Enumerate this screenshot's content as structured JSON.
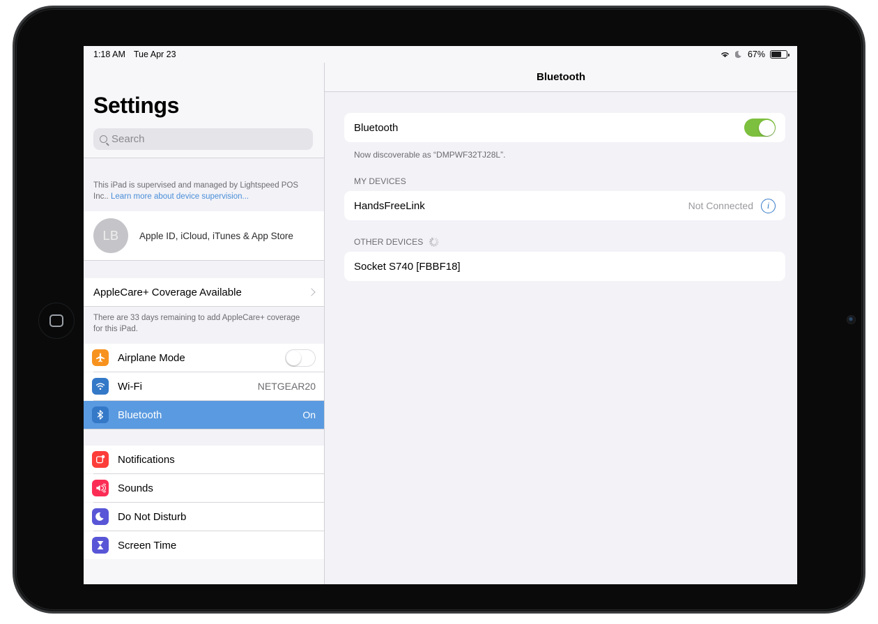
{
  "status_bar": {
    "time": "1:18 AM",
    "date": "Tue Apr 23",
    "wifi_icon": "wifi-icon",
    "dnd_icon": "moon-icon",
    "battery_percent": "67%",
    "battery_level": 67
  },
  "sidebar": {
    "title": "Settings",
    "search": {
      "placeholder": "Search",
      "icon": "search-icon"
    },
    "supervision": {
      "text": "This iPad is supervised and managed by Lightspeed POS Inc..",
      "link": "Learn more about device supervision..."
    },
    "apple_id": {
      "initials": "LB",
      "label": "Apple ID, iCloud, iTunes & App Store"
    },
    "applecare": {
      "title": "AppleCare+ Coverage Available",
      "footnote": "There are 33 days remaining to add AppleCare+ coverage for this iPad."
    },
    "items": [
      {
        "label": "Airplane Mode",
        "icon": "airplane-icon",
        "color": "#F7921E",
        "glyph": "✈",
        "control": "toggle",
        "value": "",
        "selected": false
      },
      {
        "label": "Wi-Fi",
        "icon": "wifi-icon",
        "color": "#3478C8",
        "glyph": "◟",
        "control": "value",
        "value": "NETGEAR20",
        "selected": false
      },
      {
        "label": "Bluetooth",
        "icon": "bluetooth-icon",
        "color": "#3478C8",
        "glyph": "ᛗ",
        "control": "value",
        "value": "On",
        "selected": true
      }
    ],
    "items2": [
      {
        "label": "Notifications",
        "icon": "notifications-icon",
        "color": "#FC3D39",
        "glyph": "▢",
        "selected": false
      },
      {
        "label": "Sounds",
        "icon": "sounds-icon",
        "color": "#FC2D55",
        "glyph": "ὐA",
        "selected": false
      },
      {
        "label": "Do Not Disturb",
        "icon": "moon-icon",
        "color": "#5856D6",
        "glyph": "☾",
        "selected": false
      },
      {
        "label": "Screen Time",
        "icon": "hourglass-icon",
        "color": "#5856D6",
        "glyph": "⧖",
        "selected": false
      }
    ]
  },
  "detail": {
    "title": "Bluetooth",
    "bluetooth_row_label": "Bluetooth",
    "bluetooth_enabled": true,
    "discoverable_note": "Now discoverable as “DMPWF32TJ28L”.",
    "my_devices_header": "MY DEVICES",
    "my_devices": [
      {
        "name": "HandsFreeLink",
        "status": "Not Connected",
        "info_icon": "info-icon"
      }
    ],
    "other_devices_header": "OTHER DEVICES",
    "other_devices_spinner": "loading-spinner-icon",
    "other_devices": [
      {
        "name": "Socket S740 [FBBF18]"
      }
    ]
  },
  "overlay": {
    "hand_cursor_icon": "hand-pointer-icon",
    "touch_halo_color": "#F4A656",
    "toggle_on_color": "#7DBF3E"
  },
  "device": {
    "home_button_icon": "home-button-icon",
    "camera_icon": "front-camera-icon"
  }
}
